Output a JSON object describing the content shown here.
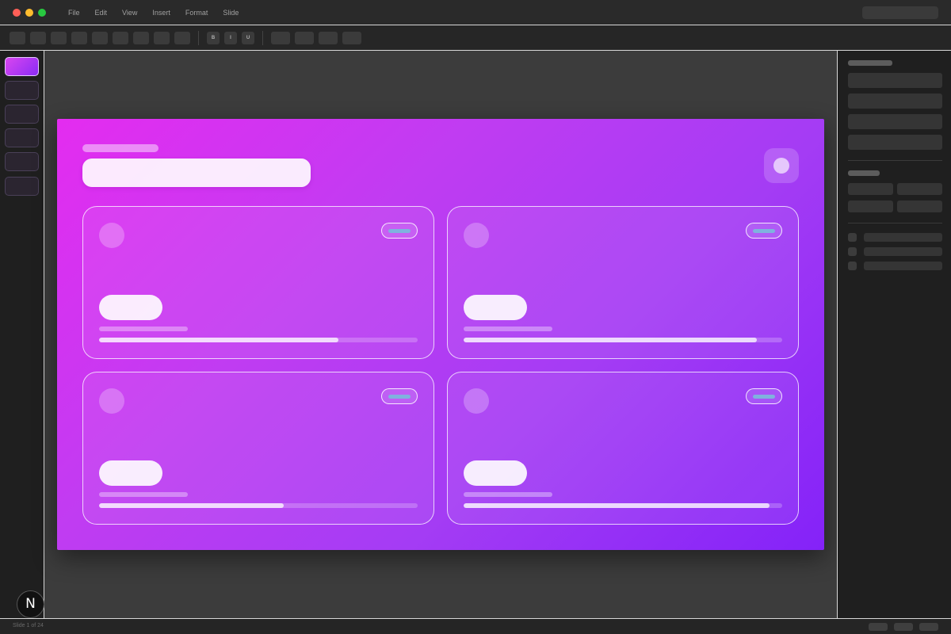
{
  "menu": [
    "File",
    "Edit",
    "View",
    "Insert",
    "Format",
    "Slide"
  ],
  "toolbar": {
    "format_buttons": [
      "B",
      "I",
      "U"
    ]
  },
  "slides": {
    "count_visible": 6,
    "active_index": 0
  },
  "status": {
    "slide_indicator": "Slide 1 of 24"
  },
  "brand": {
    "glyph": "N"
  },
  "cards": [
    {
      "progress": 0.75
    },
    {
      "progress": 0.92
    },
    {
      "progress": 0.58
    },
    {
      "progress": 0.96
    }
  ],
  "colors": {
    "slide_gradient_start": "#e42cf0",
    "slide_gradient_end": "#8422f8",
    "badge_accent": "#7fb2de",
    "traffic_red": "#ff5f57",
    "traffic_yellow": "#febc2e",
    "traffic_green": "#28c840"
  }
}
